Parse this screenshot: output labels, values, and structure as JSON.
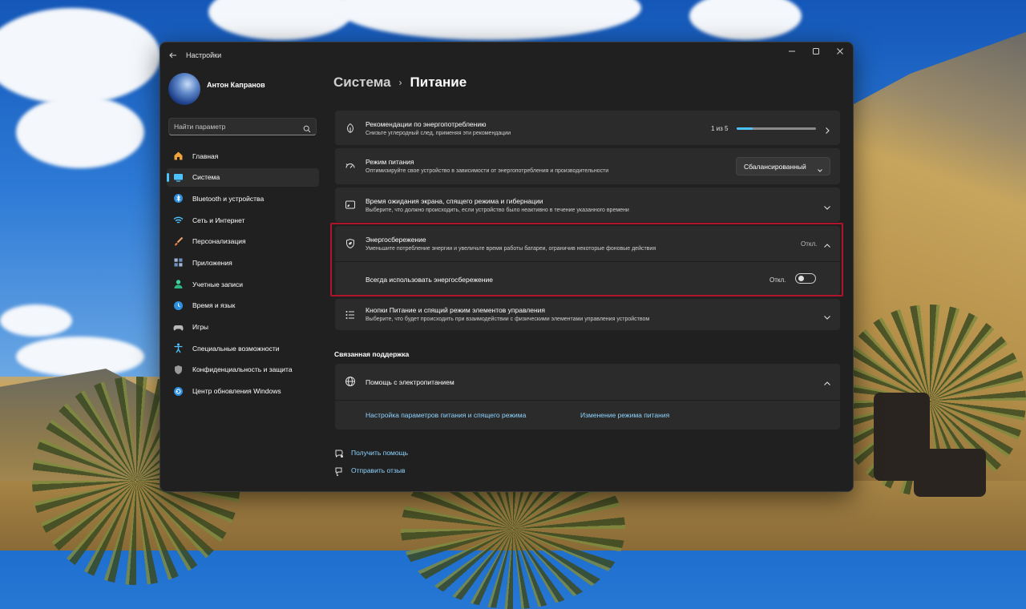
{
  "window": {
    "app_title": "Настройки",
    "user_name": "Антон Капранов"
  },
  "search": {
    "placeholder": "Найти параметр"
  },
  "sidebar": {
    "items": [
      {
        "label": "Главная",
        "icon": "home-icon",
        "color": "#f2a23a"
      },
      {
        "label": "Система",
        "icon": "monitor-icon",
        "color": "#4cc2ff",
        "active": true
      },
      {
        "label": "Bluetooth и устройства",
        "icon": "bluetooth-icon",
        "color": "#4cc2ff"
      },
      {
        "label": "Сеть и Интернет",
        "icon": "wifi-icon",
        "color": "#4cc2ff"
      },
      {
        "label": "Персонализация",
        "icon": "brush-icon",
        "color": "#f0a36b"
      },
      {
        "label": "Приложения",
        "icon": "apps-icon",
        "color": "#9fb6d8"
      },
      {
        "label": "Учетные записи",
        "icon": "person-icon",
        "color": "#3ad49a"
      },
      {
        "label": "Время и язык",
        "icon": "globe-clock-icon",
        "color": "#4cc2ff"
      },
      {
        "label": "Игры",
        "icon": "gamepad-icon",
        "color": "#b8b8b8"
      },
      {
        "label": "Специальные возможности",
        "icon": "accessibility-icon",
        "color": "#4cc2ff"
      },
      {
        "label": "Конфиденциальность и защита",
        "icon": "shield-icon",
        "color": "#9a9a9a"
      },
      {
        "label": "Центр обновления Windows",
        "icon": "update-icon",
        "color": "#4cc2ff"
      }
    ]
  },
  "breadcrumb": {
    "parent": "Система",
    "separator": "›",
    "current": "Питание"
  },
  "cards": {
    "recommendations": {
      "title": "Рекомендации по энергопотреблению",
      "desc": "Снизьте углеродный след, применяя эти рекомендации",
      "progress_text": "1 из 5",
      "progress_fraction": 0.2
    },
    "power_mode": {
      "title": "Режим питания",
      "desc": "Оптимизируйте свое устройство в зависимости от энергопотребления и производительности",
      "value": "Сбалансированный"
    },
    "screen_sleep": {
      "title": "Время ожидания экрана, спящего режима и гибернации",
      "desc": "Выберите, что должно происходить, если устройство было неактивно в течение указанного времени"
    },
    "energy_saver": {
      "title": "Энергосбережение",
      "desc": "Уменьшите потребление энергии и увеличьте время работы батареи, ограничив некоторые фоновые действия",
      "status": "Откл.",
      "always_label": "Всегда использовать энергосбережение",
      "toggle_label": "Откл.",
      "toggle_on": false
    },
    "power_buttons": {
      "title": "Кнопки Питание и спящий режим элементов управления",
      "desc": "Выберите, что будет происходить при взаимодействии с физическими элементами управления устройством"
    }
  },
  "support": {
    "section_title": "Связанная поддержка",
    "help_title": "Помощь с электропитанием",
    "links": [
      "Настройка параметров питания и спящего режима",
      "Изменение режима питания"
    ]
  },
  "footer": {
    "get_help": "Получить помощь",
    "feedback": "Отправить отзыв"
  },
  "colors": {
    "accent": "#4cc2ff",
    "highlight_border": "#b0142b",
    "link": "#8ed4ff"
  }
}
